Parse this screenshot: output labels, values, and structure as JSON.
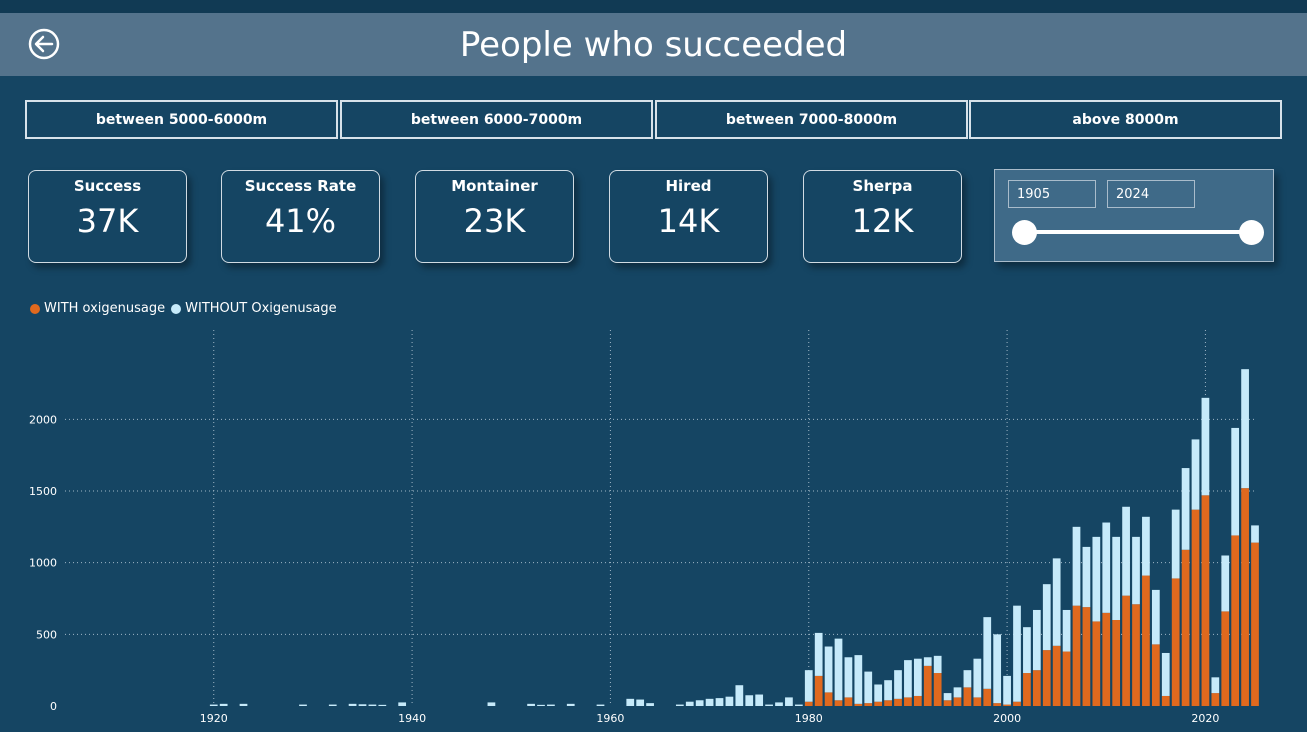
{
  "header": {
    "title": "People who succeeded"
  },
  "filters": [
    {
      "label": "between 5000-6000m"
    },
    {
      "label": "between 6000-7000m"
    },
    {
      "label": "between 7000-8000m"
    },
    {
      "label": "above 8000m"
    }
  ],
  "cards": [
    {
      "label": "Success",
      "value": "37K"
    },
    {
      "label": "Success Rate",
      "value": "41%"
    },
    {
      "label": "Montainer",
      "value": "23K"
    },
    {
      "label": "Hired",
      "value": "14K"
    },
    {
      "label": "Sherpa",
      "value": "12K"
    }
  ],
  "slicer": {
    "start": "1905",
    "end": "2024"
  },
  "colors": {
    "with": "#e0691e",
    "without": "#c6eafa",
    "background": "#154563",
    "header": "#54738c"
  },
  "chart_data": {
    "type": "bar",
    "stacked": true,
    "xlim": [
      1905,
      2025
    ],
    "ylim": [
      0,
      2400
    ],
    "x_ticks": [
      "1920",
      "1940",
      "1960",
      "1980",
      "2000",
      "2020"
    ],
    "y_ticks": [
      "0",
      "500",
      "1000",
      "1500",
      "2000"
    ],
    "grid": true,
    "legend_position": "top-left",
    "series": [
      {
        "name": "WITH oxigenusage",
        "points": [
          [
            1980,
            30
          ],
          [
            1981,
            210
          ],
          [
            1982,
            95
          ],
          [
            1983,
            40
          ],
          [
            1984,
            60
          ],
          [
            1985,
            15
          ],
          [
            1986,
            20
          ],
          [
            1987,
            30
          ],
          [
            1988,
            40
          ],
          [
            1989,
            50
          ],
          [
            1990,
            60
          ],
          [
            1991,
            70
          ],
          [
            1992,
            280
          ],
          [
            1993,
            230
          ],
          [
            1994,
            40
          ],
          [
            1995,
            60
          ],
          [
            1996,
            130
          ],
          [
            1997,
            60
          ],
          [
            1998,
            120
          ],
          [
            1999,
            20
          ],
          [
            2000,
            10
          ],
          [
            2001,
            30
          ],
          [
            2002,
            230
          ],
          [
            2003,
            250
          ],
          [
            2004,
            390
          ],
          [
            2005,
            420
          ],
          [
            2006,
            380
          ],
          [
            2007,
            700
          ],
          [
            2008,
            690
          ],
          [
            2009,
            590
          ],
          [
            2010,
            650
          ],
          [
            2011,
            600
          ],
          [
            2012,
            770
          ],
          [
            2013,
            710
          ],
          [
            2014,
            910
          ],
          [
            2015,
            430
          ],
          [
            2016,
            70
          ],
          [
            2017,
            890
          ],
          [
            2018,
            1090
          ],
          [
            2019,
            1370
          ],
          [
            2020,
            1470
          ],
          [
            2021,
            90
          ],
          [
            2022,
            660
          ],
          [
            2023,
            1190
          ],
          [
            2024,
            1520
          ],
          [
            2025,
            1140
          ]
        ]
      },
      {
        "name": "WITHOUT Oxigenusage",
        "points": [
          [
            1920,
            10
          ],
          [
            1921,
            15
          ],
          [
            1923,
            15
          ],
          [
            1929,
            10
          ],
          [
            1932,
            10
          ],
          [
            1934,
            15
          ],
          [
            1935,
            12
          ],
          [
            1936,
            10
          ],
          [
            1937,
            8
          ],
          [
            1939,
            25
          ],
          [
            1948,
            25
          ],
          [
            1952,
            15
          ],
          [
            1953,
            8
          ],
          [
            1954,
            10
          ],
          [
            1956,
            15
          ],
          [
            1959,
            10
          ],
          [
            1962,
            50
          ],
          [
            1963,
            45
          ],
          [
            1964,
            20
          ],
          [
            1967,
            10
          ],
          [
            1968,
            30
          ],
          [
            1969,
            40
          ],
          [
            1970,
            50
          ],
          [
            1971,
            55
          ],
          [
            1972,
            65
          ],
          [
            1973,
            145
          ],
          [
            1974,
            75
          ],
          [
            1975,
            80
          ],
          [
            1976,
            10
          ],
          [
            1977,
            25
          ],
          [
            1978,
            60
          ],
          [
            1979,
            10
          ],
          [
            1980,
            220
          ],
          [
            1981,
            300
          ],
          [
            1982,
            320
          ],
          [
            1983,
            430
          ],
          [
            1984,
            280
          ],
          [
            1985,
            340
          ],
          [
            1986,
            220
          ],
          [
            1987,
            120
          ],
          [
            1988,
            140
          ],
          [
            1989,
            200
          ],
          [
            1990,
            260
          ],
          [
            1991,
            260
          ],
          [
            1992,
            60
          ],
          [
            1993,
            120
          ],
          [
            1994,
            50
          ],
          [
            1995,
            70
          ],
          [
            1996,
            120
          ],
          [
            1997,
            270
          ],
          [
            1998,
            500
          ],
          [
            1999,
            480
          ],
          [
            2000,
            200
          ],
          [
            2001,
            670
          ],
          [
            2002,
            320
          ],
          [
            2003,
            420
          ],
          [
            2004,
            460
          ],
          [
            2005,
            610
          ],
          [
            2006,
            290
          ],
          [
            2007,
            550
          ],
          [
            2008,
            420
          ],
          [
            2009,
            590
          ],
          [
            2010,
            630
          ],
          [
            2011,
            580
          ],
          [
            2012,
            620
          ],
          [
            2013,
            470
          ],
          [
            2014,
            410
          ],
          [
            2015,
            380
          ],
          [
            2016,
            300
          ],
          [
            2017,
            480
          ],
          [
            2018,
            570
          ],
          [
            2019,
            490
          ],
          [
            2020,
            680
          ],
          [
            2021,
            110
          ],
          [
            2022,
            390
          ],
          [
            2023,
            750
          ],
          [
            2024,
            830
          ],
          [
            2025,
            120
          ]
        ]
      }
    ]
  }
}
